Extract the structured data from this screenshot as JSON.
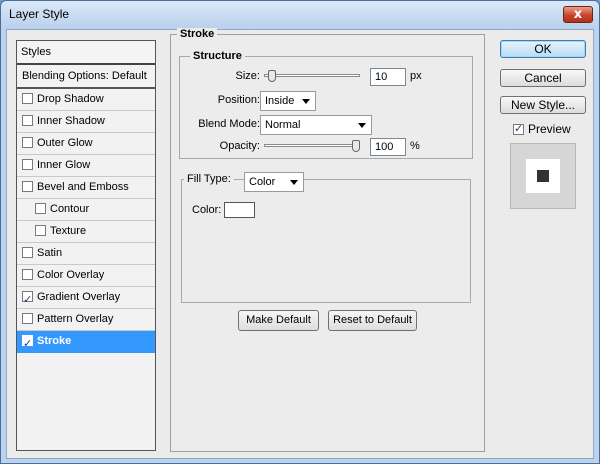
{
  "window": {
    "title": "Layer Style",
    "close_glyph": "x"
  },
  "styles_panel": {
    "header": "Styles",
    "blending_options": "Blending Options: Default",
    "items": [
      {
        "label": "Drop Shadow",
        "checked": false,
        "indent": false,
        "selected": false
      },
      {
        "label": "Inner Shadow",
        "checked": false,
        "indent": false,
        "selected": false
      },
      {
        "label": "Outer Glow",
        "checked": false,
        "indent": false,
        "selected": false
      },
      {
        "label": "Inner Glow",
        "checked": false,
        "indent": false,
        "selected": false
      },
      {
        "label": "Bevel and Emboss",
        "checked": false,
        "indent": false,
        "selected": false
      },
      {
        "label": "Contour",
        "checked": false,
        "indent": true,
        "selected": false
      },
      {
        "label": "Texture",
        "checked": false,
        "indent": true,
        "selected": false
      },
      {
        "label": "Satin",
        "checked": false,
        "indent": false,
        "selected": false
      },
      {
        "label": "Color Overlay",
        "checked": false,
        "indent": false,
        "selected": false
      },
      {
        "label": "Gradient Overlay",
        "checked": true,
        "indent": false,
        "selected": false
      },
      {
        "label": "Pattern Overlay",
        "checked": false,
        "indent": false,
        "selected": false
      },
      {
        "label": "Stroke",
        "checked": true,
        "indent": false,
        "selected": true
      }
    ]
  },
  "stroke": {
    "section_title": "Stroke",
    "structure_title": "Structure",
    "size": {
      "label": "Size:",
      "value": "10",
      "unit": "px",
      "slider_fraction": 0.04
    },
    "position": {
      "label": "Position:",
      "value": "Inside"
    },
    "blend_mode": {
      "label": "Blend Mode:",
      "value": "Normal"
    },
    "opacity": {
      "label": "Opacity:",
      "value": "100",
      "unit": "%",
      "slider_fraction": 1.0
    },
    "fill_type": {
      "label": "Fill Type:",
      "value": "Color"
    },
    "color": {
      "label": "Color:",
      "value": "#ffffff"
    },
    "make_default_label": "Make Default",
    "reset_default_label": "Reset to Default"
  },
  "actions": {
    "ok_label": "OK",
    "cancel_label": "Cancel",
    "new_style_label": "New Style...",
    "preview_label": "Preview",
    "preview_checked": true
  },
  "colors": {
    "selection": "#3399ff",
    "titlebar": "#c9dcf2",
    "close_button": "#c7452b"
  }
}
